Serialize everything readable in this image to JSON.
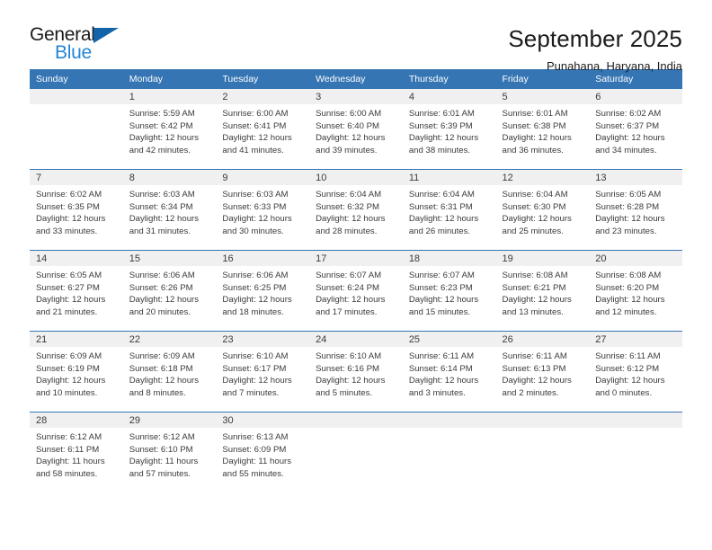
{
  "brand": {
    "word_general": "General",
    "word_blue": "Blue",
    "flag_icon": "blue-flag-icon",
    "accent_dark": "#1363a8",
    "accent_light": "#2585d3"
  },
  "header": {
    "title": "September 2025",
    "subtitle": "Punahana, Haryana, India",
    "header_bg": "#3575b4",
    "daynum_bg": "#f0f0f0"
  },
  "weekday_headers": [
    "Sunday",
    "Monday",
    "Tuesday",
    "Wednesday",
    "Thursday",
    "Friday",
    "Saturday"
  ],
  "weeks": [
    {
      "days": [
        {
          "num": "",
          "sunrise": "",
          "sunset": "",
          "daylight_1": "",
          "daylight_2": "",
          "empty": true
        },
        {
          "num": "1",
          "sunrise": "Sunrise: 5:59 AM",
          "sunset": "Sunset: 6:42 PM",
          "daylight_1": "Daylight: 12 hours",
          "daylight_2": "and 42 minutes."
        },
        {
          "num": "2",
          "sunrise": "Sunrise: 6:00 AM",
          "sunset": "Sunset: 6:41 PM",
          "daylight_1": "Daylight: 12 hours",
          "daylight_2": "and 41 minutes."
        },
        {
          "num": "3",
          "sunrise": "Sunrise: 6:00 AM",
          "sunset": "Sunset: 6:40 PM",
          "daylight_1": "Daylight: 12 hours",
          "daylight_2": "and 39 minutes."
        },
        {
          "num": "4",
          "sunrise": "Sunrise: 6:01 AM",
          "sunset": "Sunset: 6:39 PM",
          "daylight_1": "Daylight: 12 hours",
          "daylight_2": "and 38 minutes."
        },
        {
          "num": "5",
          "sunrise": "Sunrise: 6:01 AM",
          "sunset": "Sunset: 6:38 PM",
          "daylight_1": "Daylight: 12 hours",
          "daylight_2": "and 36 minutes."
        },
        {
          "num": "6",
          "sunrise": "Sunrise: 6:02 AM",
          "sunset": "Sunset: 6:37 PM",
          "daylight_1": "Daylight: 12 hours",
          "daylight_2": "and 34 minutes."
        }
      ]
    },
    {
      "days": [
        {
          "num": "7",
          "sunrise": "Sunrise: 6:02 AM",
          "sunset": "Sunset: 6:35 PM",
          "daylight_1": "Daylight: 12 hours",
          "daylight_2": "and 33 minutes."
        },
        {
          "num": "8",
          "sunrise": "Sunrise: 6:03 AM",
          "sunset": "Sunset: 6:34 PM",
          "daylight_1": "Daylight: 12 hours",
          "daylight_2": "and 31 minutes."
        },
        {
          "num": "9",
          "sunrise": "Sunrise: 6:03 AM",
          "sunset": "Sunset: 6:33 PM",
          "daylight_1": "Daylight: 12 hours",
          "daylight_2": "and 30 minutes."
        },
        {
          "num": "10",
          "sunrise": "Sunrise: 6:04 AM",
          "sunset": "Sunset: 6:32 PM",
          "daylight_1": "Daylight: 12 hours",
          "daylight_2": "and 28 minutes."
        },
        {
          "num": "11",
          "sunrise": "Sunrise: 6:04 AM",
          "sunset": "Sunset: 6:31 PM",
          "daylight_1": "Daylight: 12 hours",
          "daylight_2": "and 26 minutes."
        },
        {
          "num": "12",
          "sunrise": "Sunrise: 6:04 AM",
          "sunset": "Sunset: 6:30 PM",
          "daylight_1": "Daylight: 12 hours",
          "daylight_2": "and 25 minutes."
        },
        {
          "num": "13",
          "sunrise": "Sunrise: 6:05 AM",
          "sunset": "Sunset: 6:28 PM",
          "daylight_1": "Daylight: 12 hours",
          "daylight_2": "and 23 minutes."
        }
      ]
    },
    {
      "days": [
        {
          "num": "14",
          "sunrise": "Sunrise: 6:05 AM",
          "sunset": "Sunset: 6:27 PM",
          "daylight_1": "Daylight: 12 hours",
          "daylight_2": "and 21 minutes."
        },
        {
          "num": "15",
          "sunrise": "Sunrise: 6:06 AM",
          "sunset": "Sunset: 6:26 PM",
          "daylight_1": "Daylight: 12 hours",
          "daylight_2": "and 20 minutes."
        },
        {
          "num": "16",
          "sunrise": "Sunrise: 6:06 AM",
          "sunset": "Sunset: 6:25 PM",
          "daylight_1": "Daylight: 12 hours",
          "daylight_2": "and 18 minutes."
        },
        {
          "num": "17",
          "sunrise": "Sunrise: 6:07 AM",
          "sunset": "Sunset: 6:24 PM",
          "daylight_1": "Daylight: 12 hours",
          "daylight_2": "and 17 minutes."
        },
        {
          "num": "18",
          "sunrise": "Sunrise: 6:07 AM",
          "sunset": "Sunset: 6:23 PM",
          "daylight_1": "Daylight: 12 hours",
          "daylight_2": "and 15 minutes."
        },
        {
          "num": "19",
          "sunrise": "Sunrise: 6:08 AM",
          "sunset": "Sunset: 6:21 PM",
          "daylight_1": "Daylight: 12 hours",
          "daylight_2": "and 13 minutes."
        },
        {
          "num": "20",
          "sunrise": "Sunrise: 6:08 AM",
          "sunset": "Sunset: 6:20 PM",
          "daylight_1": "Daylight: 12 hours",
          "daylight_2": "and 12 minutes."
        }
      ]
    },
    {
      "days": [
        {
          "num": "21",
          "sunrise": "Sunrise: 6:09 AM",
          "sunset": "Sunset: 6:19 PM",
          "daylight_1": "Daylight: 12 hours",
          "daylight_2": "and 10 minutes."
        },
        {
          "num": "22",
          "sunrise": "Sunrise: 6:09 AM",
          "sunset": "Sunset: 6:18 PM",
          "daylight_1": "Daylight: 12 hours",
          "daylight_2": "and 8 minutes."
        },
        {
          "num": "23",
          "sunrise": "Sunrise: 6:10 AM",
          "sunset": "Sunset: 6:17 PM",
          "daylight_1": "Daylight: 12 hours",
          "daylight_2": "and 7 minutes."
        },
        {
          "num": "24",
          "sunrise": "Sunrise: 6:10 AM",
          "sunset": "Sunset: 6:16 PM",
          "daylight_1": "Daylight: 12 hours",
          "daylight_2": "and 5 minutes."
        },
        {
          "num": "25",
          "sunrise": "Sunrise: 6:11 AM",
          "sunset": "Sunset: 6:14 PM",
          "daylight_1": "Daylight: 12 hours",
          "daylight_2": "and 3 minutes."
        },
        {
          "num": "26",
          "sunrise": "Sunrise: 6:11 AM",
          "sunset": "Sunset: 6:13 PM",
          "daylight_1": "Daylight: 12 hours",
          "daylight_2": "and 2 minutes."
        },
        {
          "num": "27",
          "sunrise": "Sunrise: 6:11 AM",
          "sunset": "Sunset: 6:12 PM",
          "daylight_1": "Daylight: 12 hours",
          "daylight_2": "and 0 minutes."
        }
      ]
    },
    {
      "days": [
        {
          "num": "28",
          "sunrise": "Sunrise: 6:12 AM",
          "sunset": "Sunset: 6:11 PM",
          "daylight_1": "Daylight: 11 hours",
          "daylight_2": "and 58 minutes."
        },
        {
          "num": "29",
          "sunrise": "Sunrise: 6:12 AM",
          "sunset": "Sunset: 6:10 PM",
          "daylight_1": "Daylight: 11 hours",
          "daylight_2": "and 57 minutes."
        },
        {
          "num": "30",
          "sunrise": "Sunrise: 6:13 AM",
          "sunset": "Sunset: 6:09 PM",
          "daylight_1": "Daylight: 11 hours",
          "daylight_2": "and 55 minutes."
        },
        {
          "num": "",
          "sunrise": "",
          "sunset": "",
          "daylight_1": "",
          "daylight_2": "",
          "empty": true
        },
        {
          "num": "",
          "sunrise": "",
          "sunset": "",
          "daylight_1": "",
          "daylight_2": "",
          "empty": true
        },
        {
          "num": "",
          "sunrise": "",
          "sunset": "",
          "daylight_1": "",
          "daylight_2": "",
          "empty": true
        },
        {
          "num": "",
          "sunrise": "",
          "sunset": "",
          "daylight_1": "",
          "daylight_2": "",
          "empty": true
        }
      ]
    }
  ]
}
